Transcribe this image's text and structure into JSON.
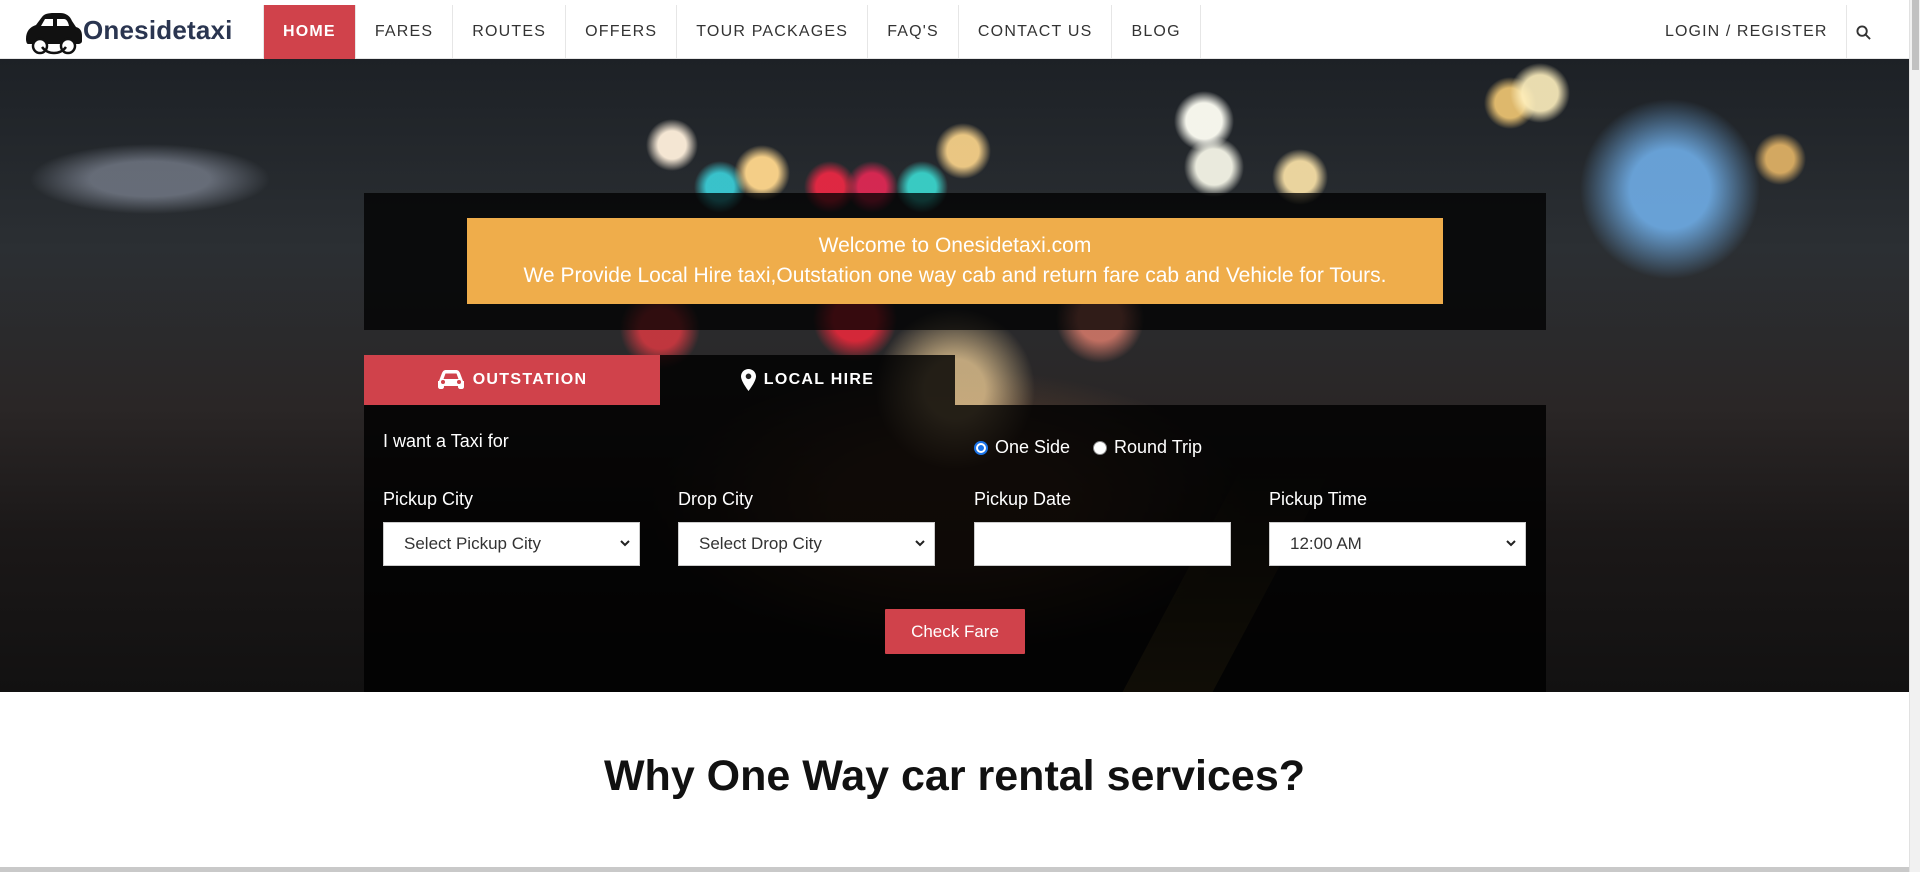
{
  "brand": {
    "name": "Onesidetaxi"
  },
  "nav": {
    "items": [
      "HOME",
      "FARES",
      "ROUTES",
      "OFFERS",
      "TOUR PACKAGES",
      "FAQ'S",
      "CONTACT US",
      "BLOG"
    ],
    "active": "HOME",
    "login": "LOGIN / REGISTER",
    "search_icon": "search-icon"
  },
  "welcome": {
    "line1": "Welcome to Onesidetaxi.com",
    "line2": "We Provide Local Hire taxi,Outstation one way cab and return fare cab and Vehicle for Tours."
  },
  "tabs": {
    "outstation": {
      "label": "OUTSTATION",
      "icon": "car-icon"
    },
    "local_hire": {
      "label": "LOCAL HIRE",
      "icon": "map-pin-icon"
    }
  },
  "form": {
    "want_label": "I want a Taxi for",
    "trip_options": [
      {
        "label": "One Side",
        "checked": true
      },
      {
        "label": "Round Trip",
        "checked": false
      }
    ],
    "pickup_city": {
      "label": "Pickup City",
      "value": "Select Pickup City"
    },
    "drop_city": {
      "label": "Drop City",
      "value": "Select Drop City"
    },
    "pickup_date": {
      "label": "Pickup Date",
      "value": ""
    },
    "pickup_time": {
      "label": "Pickup Time",
      "value": "12:00 AM"
    },
    "submit_label": "Check Fare"
  },
  "section": {
    "title": "Why One Way car rental services?"
  },
  "colors": {
    "accent": "#d0424b",
    "welcome_bg": "#efad4b",
    "brand_text": "#2a3550"
  }
}
